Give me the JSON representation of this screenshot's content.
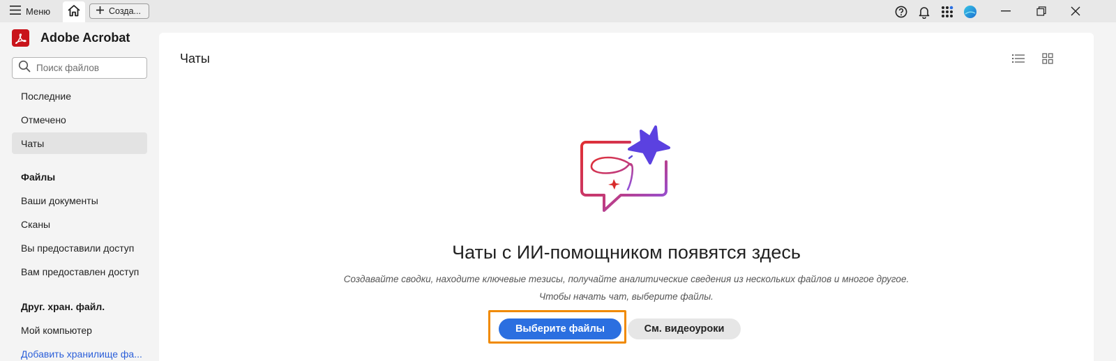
{
  "titlebar": {
    "menu_label": "Меню",
    "create_tab_label": "Созда..."
  },
  "sidebar": {
    "app_name": "Adobe Acrobat",
    "search_placeholder": "Поиск файлов",
    "items": [
      {
        "label": "Последние"
      },
      {
        "label": "Отмечено"
      },
      {
        "label": "Чаты",
        "active": true
      }
    ],
    "files_section": {
      "heading": "Файлы",
      "items": [
        {
          "label": "Ваши документы"
        },
        {
          "label": "Сканы"
        },
        {
          "label": "Вы предоставили доступ"
        },
        {
          "label": "Вам предоставлен доступ"
        }
      ]
    },
    "storage_section": {
      "heading": "Друг. хран. файл.",
      "items": [
        {
          "label": "Мой компьютер"
        },
        {
          "label": "Добавить хранилище фа..."
        }
      ]
    }
  },
  "main": {
    "title": "Чаты",
    "empty_state": {
      "title": "Чаты с ИИ-помощником появятся здесь",
      "description": "Создавайте сводки, находите ключевые тезисы, получайте аналитические сведения из нескольких файлов и многое другое.",
      "hint": "Чтобы начать чат, выберите файлы.",
      "primary_button": "Выберите файлы",
      "secondary_button": "См. видеоуроки"
    }
  },
  "colors": {
    "accent": "#2b6fe0",
    "highlight": "#f08a00",
    "brand": "#c9141b"
  }
}
